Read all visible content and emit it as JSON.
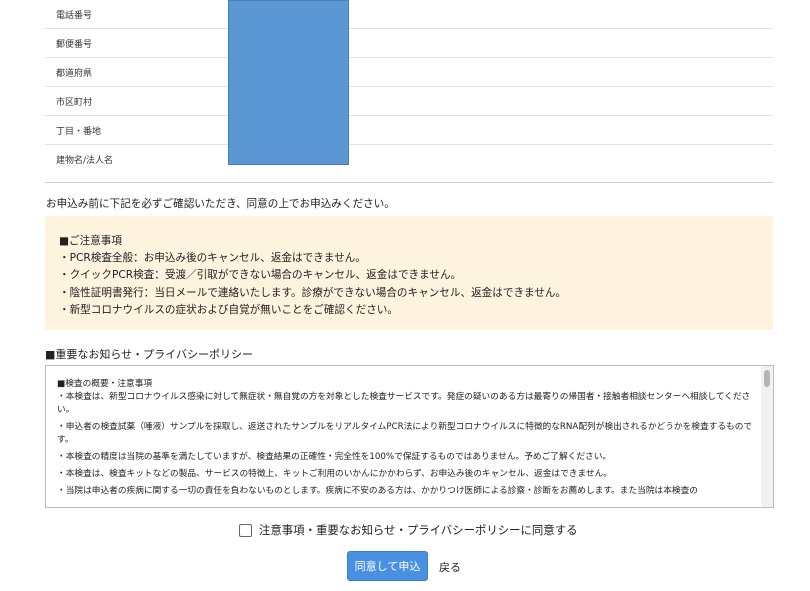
{
  "form": {
    "rows": [
      {
        "label": "電話番号"
      },
      {
        "label": "郵便番号"
      },
      {
        "label": "都道府県"
      },
      {
        "label": "市区町村"
      },
      {
        "label": "丁目・番地"
      },
      {
        "label": "建物名/法人名"
      }
    ]
  },
  "intro_text": "お申込み前に下記を必ずご確認いただき、同意の上でお申込みください。",
  "caution": {
    "title": "■ご注意事項",
    "lines": [
      "・PCR検査全般：お申込み後のキャンセル、返金はできません。",
      "・クイックPCR検査：受渡／引取ができない場合のキャンセル、返金はできません。",
      "・陰性証明書発行：当日メールで連絡いたします。診療ができない場合のキャンセル、返金はできません。",
      "・新型コロナウイルスの症状および自覚が無いことをご確認ください。"
    ]
  },
  "privacy": {
    "heading": "■重要なお知らせ・プライバシーポリシー",
    "section_title": "■検査の概要・注意事項",
    "paragraphs": [
      "・本検査は、新型コロナウイルス感染に対して無症状・無自覚の方を対象とした検査サービスです。発症の疑いのある方は最寄りの帰国者・接触者相談センターへ相談してください。",
      "・申込者の検査試薬（唾液）サンプルを採取し、返送されたサンプルをリアルタイムPCR法により新型コロナウイルスに特徴的なRNA配列が検出されるかどうかを検査するものです。",
      "・本検査の精度は当院の基準を満たしていますが、検査結果の正確性・完全性を100%で保証するものではありません。予めご了解ください。",
      "・本検査は、検査キットなどの製品、サービスの特徴上、キットご利用のいかんにかかわらず、お申込み後のキャンセル、返金はできません。",
      "・当院は申込者の疾病に関する一切の責任を負わないものとします。疾病に不安のある方は、かかりつけ医師による診察・診断をお薦めします。また当院は本検査の"
    ]
  },
  "consent_label": "注意事項・重要なお知らせ・プライバシーポリシーに同意する",
  "buttons": {
    "submit": "同意して申込",
    "back": "戻る"
  }
}
